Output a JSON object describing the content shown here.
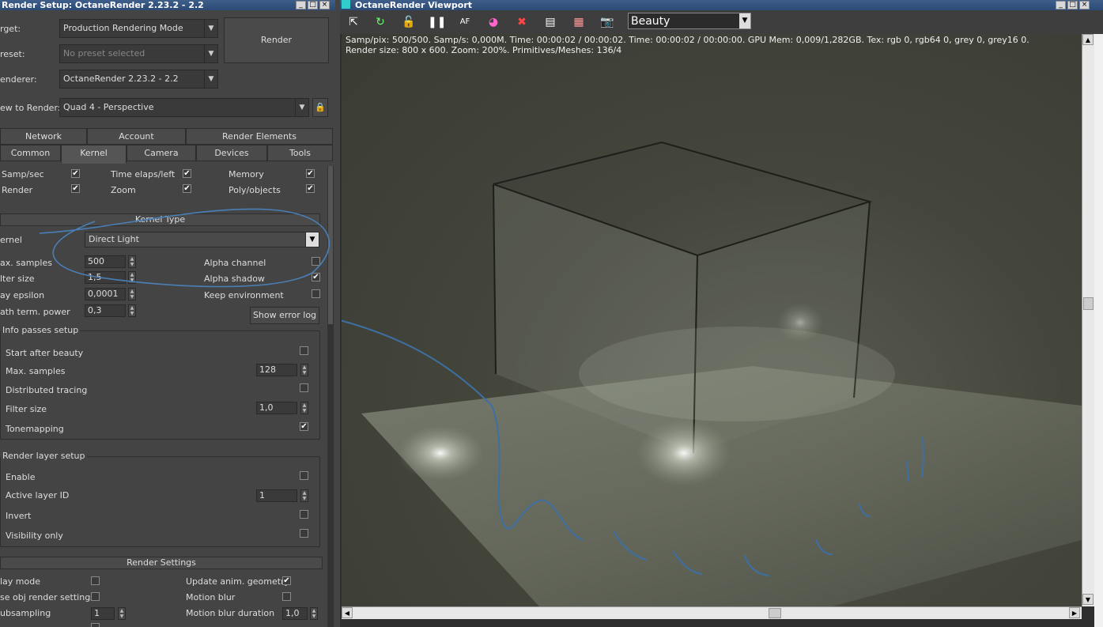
{
  "left": {
    "title": "Render Setup: OctaneRender 2.23.2 - 2.2",
    "target_label": "rget:",
    "target_value": "Production Rendering Mode",
    "preset_label": "reset:",
    "preset_value": "No preset selected",
    "renderer_label": "enderer:",
    "renderer_value": "OctaneRender 2.23.2 - 2.2",
    "view_label": "ew to Render:",
    "view_value": "Quad 4 - Perspective",
    "render_button": "Render",
    "tabs_row1": [
      "Network",
      "Account",
      "Render Elements"
    ],
    "tabs_row2": [
      "Common",
      "Kernel",
      "Camera",
      "Devices",
      "Tools"
    ],
    "active_tab": "Kernel",
    "info": {
      "samp_sec": "Samp/sec",
      "time_elaps": "Time elaps/left",
      "memory": "Memory",
      "render": "Render",
      "zoom": "Zoom",
      "poly": "Poly/objects"
    },
    "kernel": {
      "title": "Kernel Type",
      "kernel_label": "ernel",
      "kernel_value": "Direct Light",
      "max_samples_label": "ax. samples",
      "max_samples_value": "500",
      "filter_label": "lter size",
      "filter_value": "1,5",
      "ray_eps_label": "ay epsilon",
      "ray_eps_value": "0,0001",
      "path_label": "ath term. power",
      "path_value": "0,3",
      "alpha_channel": "Alpha channel",
      "alpha_shadow": "Alpha shadow",
      "keep_env": "Keep environment",
      "show_error_log": "Show error log"
    },
    "info_passes": {
      "title": "Info passes setup",
      "start_after_beauty": "Start after beauty",
      "max_samples": "Max. samples",
      "max_samples_value": "128",
      "distributed": "Distributed tracing",
      "filter": "Filter size",
      "filter_value": "1,0",
      "tonemapping": "Tonemapping"
    },
    "render_layer": {
      "title": "Render layer setup",
      "enable": "Enable",
      "active_layer": "Active layer ID",
      "active_layer_value": "1",
      "invert": "Invert",
      "visibility_only": "Visibility only"
    },
    "render_settings": {
      "title": "Render Settings",
      "lay_mode": "lay mode",
      "use_obj": "se obj render settings",
      "subsampling": "ubsampling",
      "subsampling_value": "1",
      "update_anim": "Update anim. geometry",
      "motion_blur": "Motion blur",
      "motion_blur_duration": "Motion blur duration",
      "motion_blur_duration_value": "1,0"
    }
  },
  "viewport": {
    "title": "OctaneRender Viewport",
    "pass_value": "Beauty",
    "stats_line1": "Samp/pix: 500/500.   Samp/s: 0,000M.   Time: 00:00:02 / 00:00:02.   Time: 00:00:02 / 00:00:00.   GPU Mem: 0,009/1,282GB.   Tex: rgb 0, rgb64 0, grey 0, grey16 0.",
    "stats_line2": "Render size: 800 x 600.   Zoom: 200%.   Primitives/Meshes: 136/4"
  }
}
